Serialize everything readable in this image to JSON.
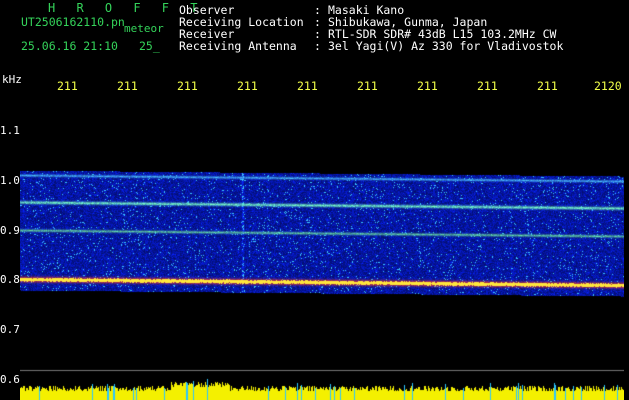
{
  "header": {
    "title": "H R O F F T",
    "filename": "UT2506162110.pn",
    "meteor_label": "meteor",
    "datetime": "25.06.16 21:10",
    "value_25": "25_"
  },
  "info": [
    {
      "label": "Observer",
      "colon": ":",
      "value": "Masaki Kano"
    },
    {
      "label": "Receiving Location",
      "colon": ":",
      "value": "Shibukawa, Gunma, Japan"
    },
    {
      "label": "Receiver",
      "colon": ":",
      "value": "RTL-SDR SDR# 43dB L15 103.2MHz CW"
    },
    {
      "label": "Receiving Antenna",
      "colon": ":",
      "value": "3el Yagi(V) Az 330 for Vladivostok"
    }
  ],
  "axis": {
    "y_unit": "kHz",
    "y_ticks": [
      "1.1",
      "1.0",
      "0.9",
      "0.8",
      "0.7",
      "0.6"
    ],
    "x_ticks": [
      "211",
      "211",
      "211",
      "211",
      "211",
      "211",
      "211",
      "211",
      "211",
      "2120"
    ]
  },
  "colors": {
    "background": "#000000",
    "header_text": "#34d35a",
    "info_text": "#ffffff",
    "time_ticks": "#f2ff4a",
    "noise_base": "#1a2fb8"
  }
}
